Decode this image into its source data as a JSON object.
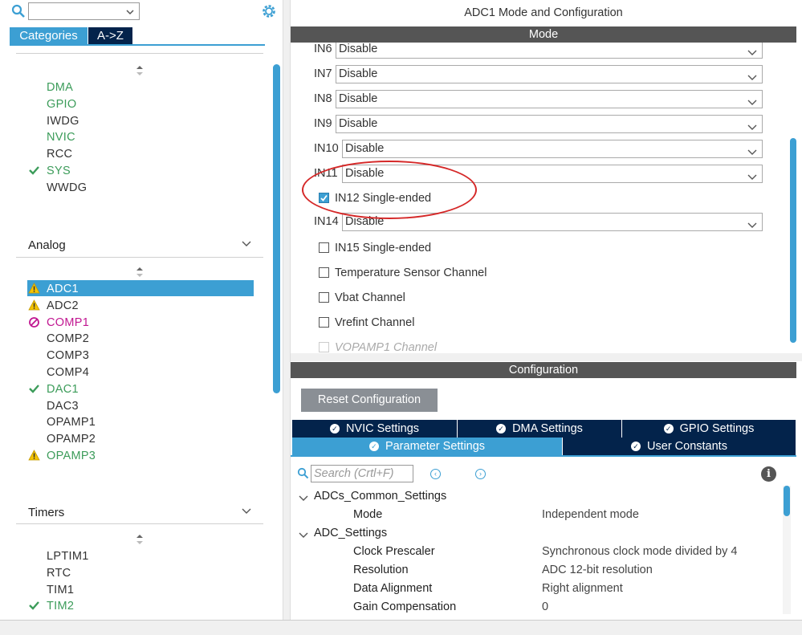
{
  "sidebar": {
    "search": {
      "value": ""
    },
    "tabs": [
      {
        "label": "Categories",
        "active": true
      },
      {
        "label": "A->Z",
        "active": false
      }
    ],
    "system_core_items": [
      {
        "label": "DMA",
        "status": "green",
        "icon": ""
      },
      {
        "label": "GPIO",
        "status": "green",
        "icon": ""
      },
      {
        "label": "IWDG",
        "status": "normal",
        "icon": ""
      },
      {
        "label": "NVIC",
        "status": "green",
        "icon": ""
      },
      {
        "label": "RCC",
        "status": "normal",
        "icon": ""
      },
      {
        "label": "SYS",
        "status": "green",
        "icon": "check-icon"
      },
      {
        "label": "WWDG",
        "status": "normal",
        "icon": ""
      }
    ],
    "analog": {
      "title": "Analog",
      "items": [
        {
          "label": "ADC1",
          "status": "selected",
          "icon": "warning-icon"
        },
        {
          "label": "ADC2",
          "status": "normal",
          "icon": "warning-icon"
        },
        {
          "label": "COMP1",
          "status": "pink",
          "icon": "forbidden-icon"
        },
        {
          "label": "COMP2",
          "status": "normal",
          "icon": ""
        },
        {
          "label": "COMP3",
          "status": "normal",
          "icon": ""
        },
        {
          "label": "COMP4",
          "status": "normal",
          "icon": ""
        },
        {
          "label": "DAC1",
          "status": "green",
          "icon": "check-icon"
        },
        {
          "label": "DAC3",
          "status": "normal",
          "icon": ""
        },
        {
          "label": "OPAMP1",
          "status": "normal",
          "icon": ""
        },
        {
          "label": "OPAMP2",
          "status": "normal",
          "icon": ""
        },
        {
          "label": "OPAMP3",
          "status": "green",
          "icon": "warning-icon"
        }
      ]
    },
    "timers": {
      "title": "Timers",
      "items": [
        {
          "label": "LPTIM1",
          "status": "normal",
          "icon": ""
        },
        {
          "label": "RTC",
          "status": "normal",
          "icon": ""
        },
        {
          "label": "TIM1",
          "status": "normal",
          "icon": ""
        },
        {
          "label": "TIM2",
          "status": "green",
          "icon": "check-icon"
        }
      ]
    }
  },
  "main": {
    "title": "ADC1 Mode and Configuration",
    "mode_bar": "Mode",
    "mode_rows": [
      {
        "label": "IN6",
        "value": "Disable"
      },
      {
        "label": "IN7",
        "value": "Disable"
      },
      {
        "label": "IN8",
        "value": "Disable"
      },
      {
        "label": "IN9",
        "value": "Disable"
      },
      {
        "label": "IN10",
        "value": "Disable"
      },
      {
        "label": "IN11",
        "value": "Disable"
      }
    ],
    "in12": {
      "label": "IN12 Single-ended",
      "checked": true
    },
    "in14": {
      "label": "IN14",
      "value": "Disable"
    },
    "checkboxes": [
      {
        "label": "IN15 Single-ended",
        "checked": false
      },
      {
        "label": "Temperature Sensor Channel",
        "checked": false
      },
      {
        "label": "Vbat Channel",
        "checked": false
      },
      {
        "label": "Vrefint Channel",
        "checked": false
      },
      {
        "label": "VOPAMP1 Channel",
        "checked": false,
        "disabled": true
      }
    ],
    "config_bar": "Configuration",
    "reset_label": "Reset Configuration",
    "tabs_row1": [
      "NVIC Settings",
      "DMA Settings",
      "GPIO Settings"
    ],
    "tabs_row2": [
      "Parameter Settings",
      "User Constants"
    ],
    "active_tab": "Parameter Settings",
    "param_search_placeholder": "Search (Crtl+F)",
    "params": {
      "groups": [
        {
          "title": "ADCs_Common_Settings",
          "rows": [
            {
              "name": "Mode",
              "value": "Independent mode"
            }
          ]
        },
        {
          "title": "ADC_Settings",
          "rows": [
            {
              "name": "Clock Prescaler",
              "value": "Synchronous clock mode divided by 4"
            },
            {
              "name": "Resolution",
              "value": "ADC 12-bit resolution"
            },
            {
              "name": "Data Alignment",
              "value": "Right alignment"
            },
            {
              "name": "Gain Compensation",
              "value": "0"
            }
          ]
        }
      ]
    }
  },
  "colors": {
    "accent": "#3c9fd3",
    "navy": "#03234b",
    "bar": "#555555",
    "green": "#3c9c5a",
    "pink": "#c11791",
    "warning": "#f5c400",
    "annotation": "#d52828"
  }
}
